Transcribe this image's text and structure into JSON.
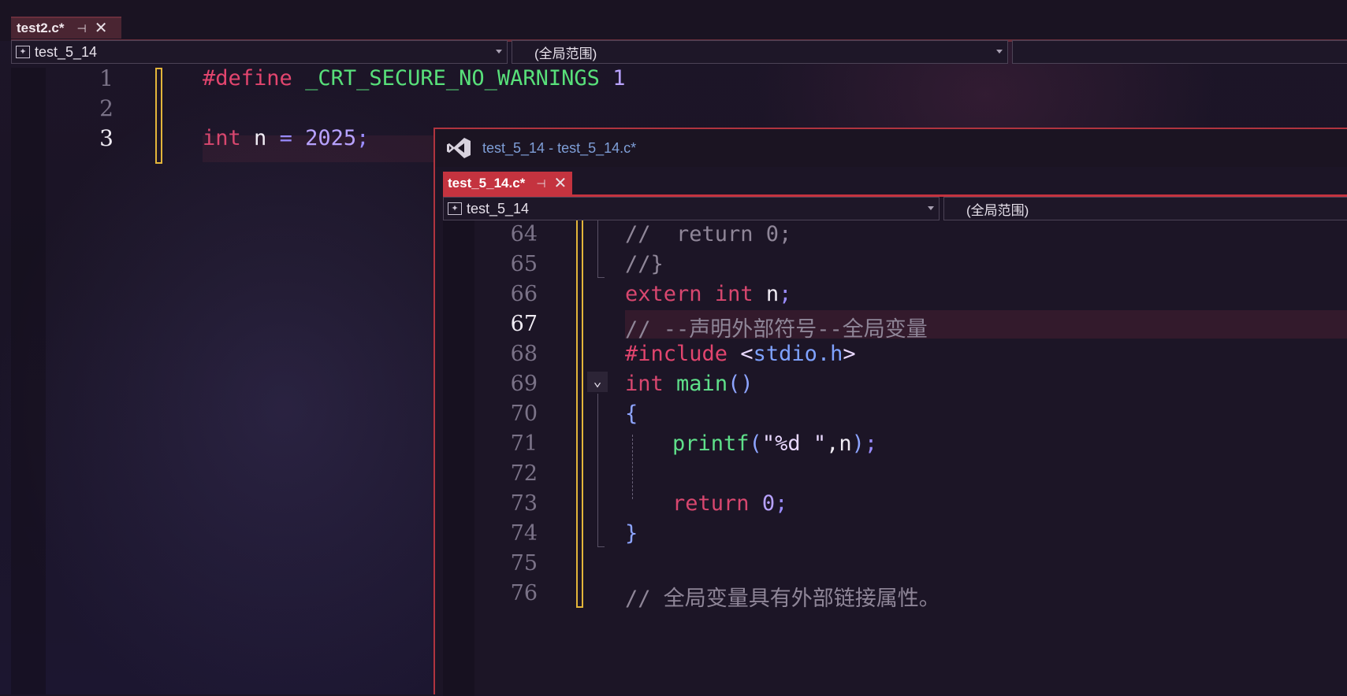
{
  "back_window": {
    "tab": {
      "label": "test2.c*",
      "pin_glyph": "⊣",
      "close_glyph": "✕"
    },
    "project_dropdown": {
      "value": "test_5_14"
    },
    "scope_dropdown": {
      "value": "(全局范围)"
    },
    "lines": [
      {
        "number": "1",
        "current": false
      },
      {
        "number": "2",
        "current": false
      },
      {
        "number": "3",
        "current": true
      }
    ],
    "code": {
      "line1": {
        "directive": "#define",
        "macro": "_CRT_SECURE_NO_WARNINGS",
        "value": "1"
      },
      "line3": {
        "type": "int",
        "name": "n",
        "op": "=",
        "value": "2025",
        "end": ";"
      }
    }
  },
  "front_window": {
    "title": "test_5_14 - test_5_14.c*",
    "logo_icon": "visual-studio-icon",
    "tab": {
      "label": "test_5_14.c*",
      "pin_glyph": "⊣",
      "close_glyph": "✕"
    },
    "project_dropdown": {
      "value": "test_5_14"
    },
    "scope_dropdown": {
      "value": "(全局范围)"
    },
    "current_line": "67",
    "line_numbers": [
      "64",
      "65",
      "66",
      "67",
      "68",
      "69",
      "70",
      "71",
      "72",
      "73",
      "74",
      "75",
      "76"
    ],
    "code": {
      "l64": "//  return 0;",
      "l65": "//}",
      "l66": {
        "kw": "extern",
        "type": "int",
        "name": "n",
        "end": ";"
      },
      "l67": "// --声明外部符号--全局变量",
      "l68": {
        "directive": "#include",
        "open": "<",
        "header": "stdio.h",
        "close": ">"
      },
      "l69": {
        "type": "int",
        "fn": "main",
        "parens": "()"
      },
      "l70": "{",
      "l71": {
        "fn": "printf",
        "open": "(",
        "str": "\"%d \"",
        "comma": ",",
        "arg": "n",
        "close": ")",
        "end": ";"
      },
      "l73": {
        "kw": "return",
        "value": "0",
        "end": ";"
      },
      "l74": "}",
      "l76": "// 全局变量具有外部链接属性。"
    },
    "fold_icon": "chevron-down-icon"
  }
}
